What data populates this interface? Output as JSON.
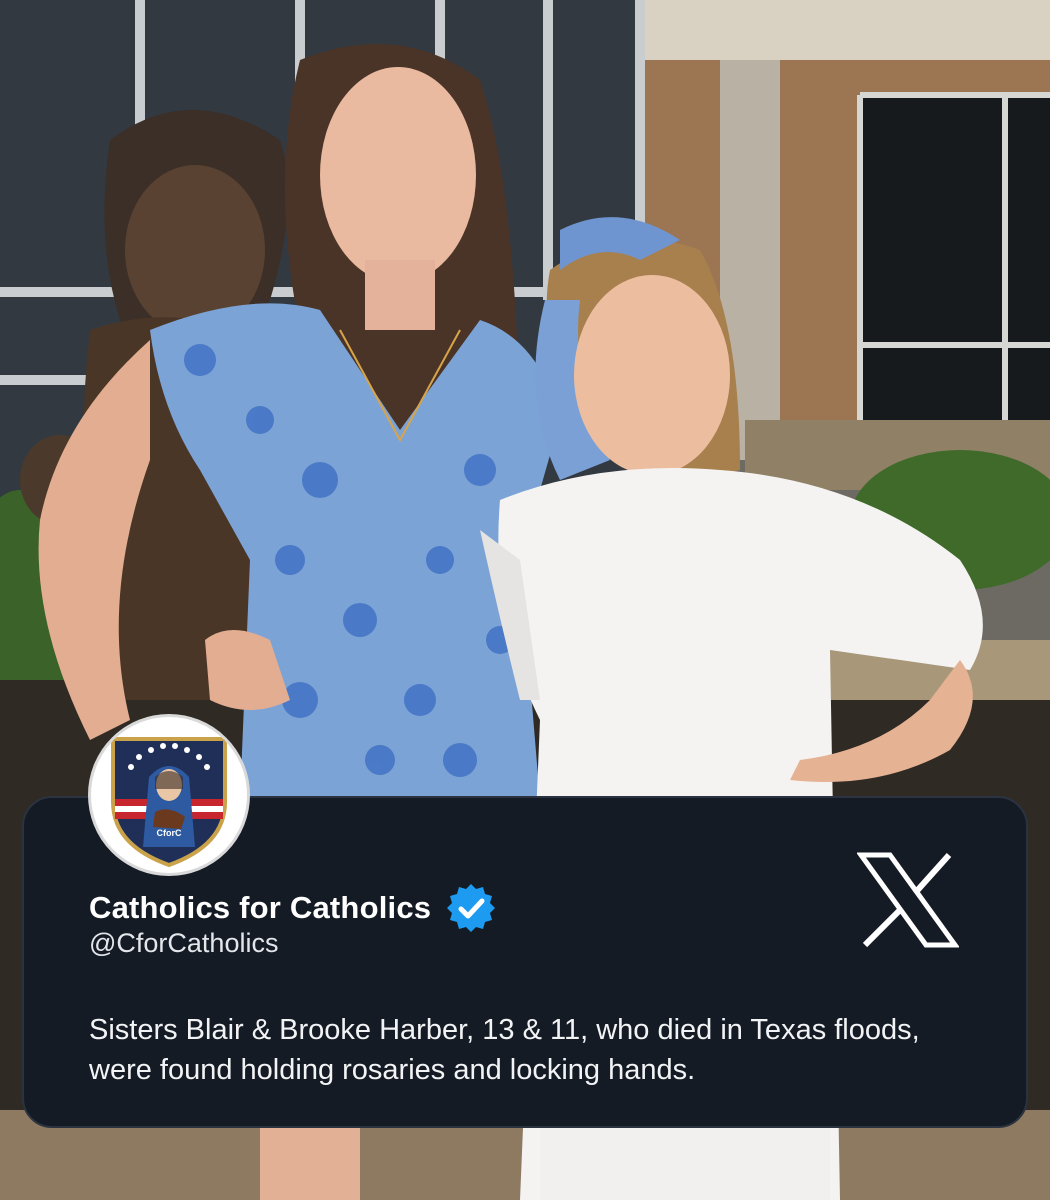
{
  "post": {
    "display_name": "Catholics for Catholics",
    "handle": "@CforCatholics",
    "text": "Sisters Blair & Brooke Harber, 13 & 11, who died in Texas floods, were found holding rosaries and locking hands.",
    "verified": true,
    "avatar_label": "CforC",
    "platform_icon": "x-logo-icon",
    "verified_icon": "verified-badge-icon"
  },
  "colors": {
    "card_background": "#151b24",
    "verified_blue": "#1d9bf0",
    "text": "#ffffff"
  }
}
